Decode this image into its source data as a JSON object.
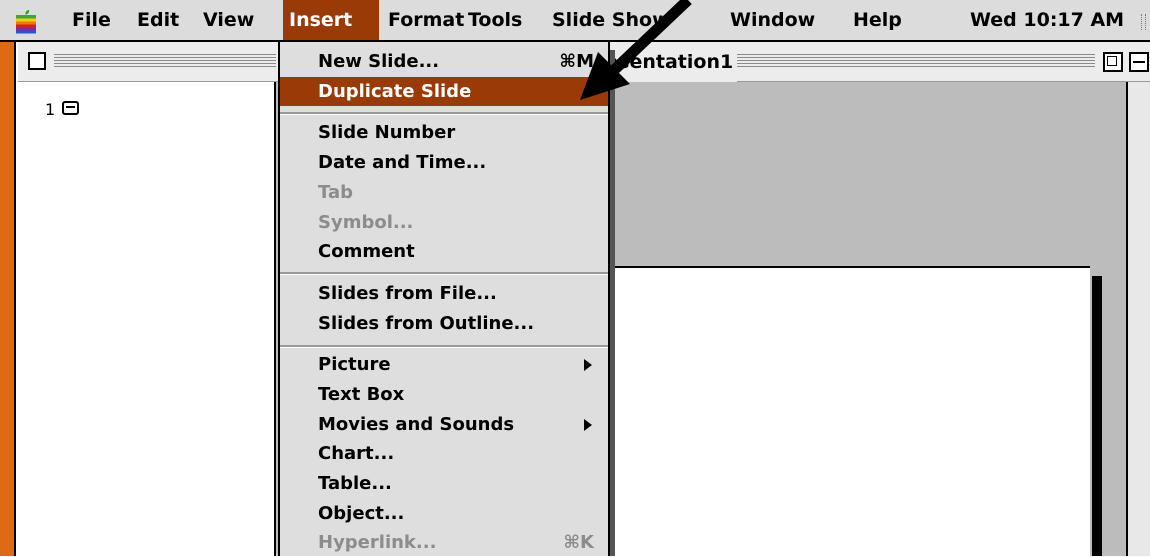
{
  "menubar": {
    "items": [
      "File",
      "Edit",
      "View",
      "Insert",
      "Format",
      "Tools",
      "Slide Show",
      "Window",
      "Help"
    ],
    "active": "Insert",
    "clock": "Wed 10:17 AM"
  },
  "window": {
    "title": "Presentation1"
  },
  "outline": {
    "slide_number": "1"
  },
  "insert_menu": {
    "items": [
      {
        "label": "New Slide...",
        "shortcut": "⌘M",
        "enabled": true
      },
      {
        "label": "Duplicate Slide",
        "enabled": true,
        "highlighted": true
      },
      {
        "label": "Slide Number",
        "enabled": true
      },
      {
        "label": "Date and Time...",
        "enabled": true
      },
      {
        "label": "Tab",
        "enabled": false
      },
      {
        "label": "Symbol...",
        "enabled": false
      },
      {
        "label": "Comment",
        "enabled": true
      },
      {
        "label": "Slides from File...",
        "enabled": true
      },
      {
        "label": "Slides from Outline...",
        "enabled": true
      },
      {
        "label": "Picture",
        "enabled": true,
        "submenu": true
      },
      {
        "label": "Text Box",
        "enabled": true
      },
      {
        "label": "Movies and Sounds",
        "enabled": true,
        "submenu": true
      },
      {
        "label": "Chart...",
        "enabled": true
      },
      {
        "label": "Table...",
        "enabled": true
      },
      {
        "label": "Object...",
        "enabled": true
      },
      {
        "label": "Hyperlink...",
        "shortcut": "⌘K",
        "enabled": false
      }
    ]
  },
  "colors": {
    "menu_highlight": "#9a3a06",
    "window_frame_accent": "#e06a14"
  },
  "icons": [
    "apple-icon",
    "close-box-icon",
    "zoom-box-icon",
    "collapse-box-icon",
    "slide-icon",
    "submenu-arrow-icon"
  ]
}
